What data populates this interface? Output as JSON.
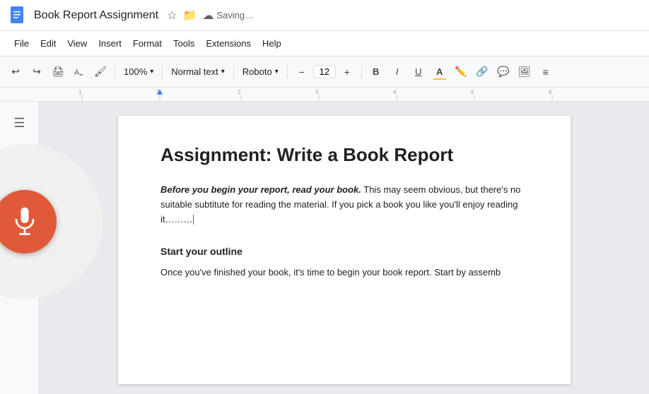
{
  "app": {
    "title": "Book Report Assignment",
    "doc_icon_color": "#1a73e8",
    "saving_status": "Saving…"
  },
  "menu": {
    "items": [
      "File",
      "Edit",
      "View",
      "Insert",
      "Format",
      "Tools",
      "Extensions",
      "Help"
    ]
  },
  "toolbar": {
    "zoom": "100%",
    "paragraph_style": "Normal text",
    "font_family": "Roboto",
    "font_size": "12",
    "undo_label": "Undo",
    "redo_label": "Redo",
    "print_label": "Print",
    "paint_label": "Paint format",
    "zoom_label": "Zoom",
    "bold_label": "B",
    "italic_label": "I",
    "underline_label": "U",
    "text_color_label": "A",
    "highlight_label": "✏",
    "link_label": "🔗",
    "comment_label": "💬",
    "image_label": "🖼",
    "more_label": "≡",
    "plus_label": "+",
    "minus_label": "−"
  },
  "sidebar": {
    "outline_icon": "outline"
  },
  "voice": {
    "mic_label": "Microphone",
    "button_color": "#e05a3a"
  },
  "document": {
    "title": "Assignment: Write a Book Report",
    "paragraph1_bold_italic": "Before you begin your report, read your book.",
    "paragraph1_rest": " This may seem obvious, but there's no suitable subtitute for reading the material. If you pick a book you like you'll enjoy reading it…",
    "cursor_visible": true,
    "section2_title": "Start your outline",
    "section2_body": "Once you've finished your book, it's time to begin your book report. Start by assemb"
  }
}
